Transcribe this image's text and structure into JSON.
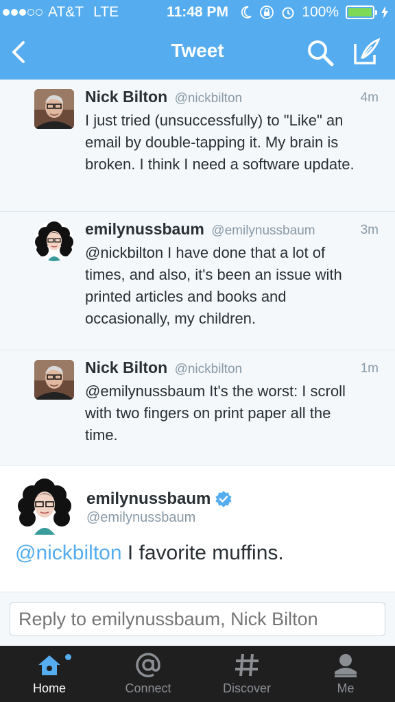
{
  "status": {
    "carrier": "AT&T",
    "network": "LTE",
    "time": "11:48 PM",
    "battery": "100%",
    "signal_bars_filled": 3,
    "signal_bars_total": 5
  },
  "nav": {
    "title": "Tweet",
    "back_icon": "chevron-left-icon",
    "search_icon": "search-icon",
    "compose_icon": "compose-icon"
  },
  "tweets": [
    {
      "name": "Nick Bilton",
      "handle": "@nickbilton",
      "time": "4m",
      "text": "I just tried (unsuccessfully) to \"Like\" an email by double-tapping it. My brain is broken. I think I need a software update."
    },
    {
      "name": "emilynussbaum",
      "handle": "@emilynussbaum",
      "time": "3m",
      "text": "@nickbilton I have done that a lot of times, and also, it's been an issue with printed articles and books and occasionally, my children."
    },
    {
      "name": "Nick Bilton",
      "handle": "@nickbilton",
      "time": "1m",
      "text": "@emilynussbaum It's the worst: I scroll with two fingers on print paper all the time."
    }
  ],
  "main_tweet": {
    "name": "emilynussbaum",
    "handle": "@emilynussbaum",
    "mention": "@nickbilton",
    "text": " I favorite muffins."
  },
  "reply": {
    "placeholder": "Reply to emilynussbaum, Nick Bilton"
  },
  "tabs": [
    {
      "label": "Home",
      "icon": "home-icon",
      "active": true
    },
    {
      "label": "Connect",
      "icon": "at-icon",
      "active": false
    },
    {
      "label": "Discover",
      "icon": "hashtag-icon",
      "active": false
    },
    {
      "label": "Me",
      "icon": "person-icon",
      "active": false
    }
  ],
  "colors": {
    "brand": "#55acee",
    "battery": "#7ed957",
    "tabbar": "#1f1f1f"
  }
}
